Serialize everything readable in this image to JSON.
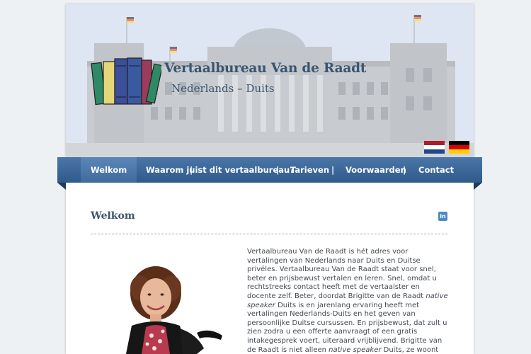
{
  "brand": {
    "title": "Vertaalbureau Van de Raadt",
    "subtitle": "Nederlands – Duits"
  },
  "flags": [
    {
      "name": "nl",
      "colors": [
        "#ae1c28",
        "#ffffff",
        "#21468b"
      ]
    },
    {
      "name": "de",
      "colors": [
        "#000000",
        "#dd0000",
        "#ffce00"
      ]
    }
  ],
  "nav": {
    "items": [
      {
        "label": "Welkom",
        "active": true
      },
      {
        "label": "Waarom juist dit vertaalbureau?"
      },
      {
        "label": "Tarieven"
      },
      {
        "label": "Voorwaarden"
      },
      {
        "label": "Contact"
      }
    ],
    "separator": "|"
  },
  "content": {
    "title": "Welkom",
    "share_icon": "linkedin-icon",
    "share_icon_text": "in",
    "paragraph": {
      "p1": "Vertaalbureau Van de Raadt is hét adres voor vertalingen van Nederlands naar Duits en Duitse privéles. Vertaalbureau Van de Raadt staat voor snel, beter en prijsbewust vertalen en leren. Snel, omdat u rechtstreeks contact heeft met de vertaalster en docente zelf. Beter, doordat Brigitte van de Raadt ",
      "em1": "native speaker",
      "p2": " Duits is en jarenlang ervaring heeft met vertalingen Nederlands-Duits en het geven van persoonlijke Duitse cursussen. En prijsbewust, dat zult u zien zodra u een offerte aanvraagt of een gratis intakegesprek voert, uiteraard vrijblijvend. Brigitte van de Raadt is niet alleen ",
      "em2": "native speaker",
      "p3": " Duits, ze woont ook al jaren in Nederland, van waaruit ze klanten in"
    }
  },
  "colors": {
    "nav_bg": "#2f5a8a",
    "heading": "#3a5470",
    "text": "#444a52"
  }
}
